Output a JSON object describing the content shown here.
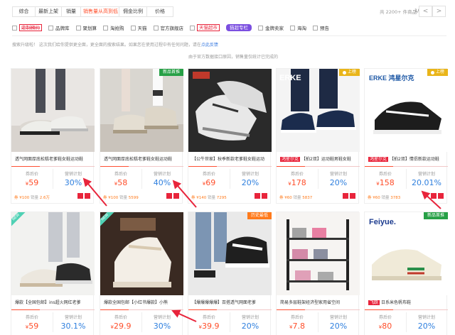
{
  "sort": {
    "buttons": [
      "综合",
      "最新上架",
      "销量",
      "销售量从高到低",
      "佣金比例",
      "价格"
    ],
    "total": "共 2200+ 件商品",
    "page": "1/23",
    "prev": "<",
    "next": ">"
  },
  "filters": {
    "items": [
      "定制预约",
      "品牌库",
      "聚划算",
      "淘抢购",
      "天猫",
      "官方旗舰店",
      "天猫超市"
    ],
    "badge": "猫超专栏",
    "items2": [
      "金牌卖家",
      "海淘",
      "预告"
    ]
  },
  "notice": {
    "text": "搜索升级啦！ 这次我们给你提供更全面，更全面的搜索结果。如果您在使用过程中有任何问题，请在",
    "link": "点此反馈",
    "text2": "由于官方数据接口原因，销售量仅统计已完成的"
  },
  "labels": {
    "coupon": "券后价",
    "plan": "营销计划"
  },
  "products": [
    {
      "tag": "",
      "shop": "",
      "title": "透气网面厚底松糕老爹鞋女鞋运动鞋",
      "price": "59",
      "rate": "30%",
      "coupon": "券 ¥100",
      "sales_label": "销量",
      "sales": "2.6万"
    },
    {
      "tag": "新品首推",
      "shop": "",
      "title": "透气网面厚底松糕老爹鞋女鞋运动鞋",
      "price": "58",
      "rate": "40%",
      "coupon": "券 ¥100",
      "sales_label": "销量",
      "sales": "5599"
    },
    {
      "tag": "",
      "shop": "",
      "title": "【公牛世家】秋季新款老爹鞋女鞋运动",
      "price": "69",
      "rate": "20%",
      "coupon": "券 ¥140",
      "sales_label": "销量",
      "sales": "7295"
    },
    {
      "tag": "上榜",
      "shop": "鸿星尔克",
      "title": "【拍2双】运动鞋男鞋女鞋",
      "price": "178",
      "rate": "20%",
      "coupon": "券 ¥60",
      "sales_label": "销量",
      "sales": "5837"
    },
    {
      "tag": "上榜",
      "shop": "鸿星尔克",
      "title": "【拍2双】情侣新款运动鞋",
      "price": "158",
      "rate": "20.01%",
      "coupon": "券 ¥60",
      "sales_label": "销量",
      "sales": "3783"
    },
    {
      "tag": "",
      "shop": "",
      "title": "爆款【全国包邮】ins超火网红老爹",
      "price": "59",
      "rate": "30.1%",
      "coupon": "",
      "sales_label": "",
      "sales": ""
    },
    {
      "tag": "",
      "shop": "",
      "title": "爆款全国包邮【小红书爆款】小熊",
      "price": "29.9",
      "rate": "30%",
      "coupon": "",
      "sales_label": "",
      "sales": ""
    },
    {
      "tag": "历史最低",
      "shop": "",
      "title": "【爆爆爆爆爆】百搭透气网面老爹",
      "price": "39.9",
      "rate": "20%",
      "coupon": "",
      "sales_label": "",
      "sales": ""
    },
    {
      "tag": "",
      "shop": "",
      "title": "简易多层鞋架经济型家用省空间",
      "price": "7.8",
      "rate": "20%",
      "coupon": "",
      "sales_label": "",
      "sales": ""
    },
    {
      "tag": "新品首推",
      "shop": "飞跃",
      "title": "日系米色帆布鞋",
      "price": "80",
      "rate": "20%",
      "coupon": "",
      "sales_label": "",
      "sales": ""
    }
  ],
  "brand_logos": [
    "ERKE",
    "ERKE 鸿星尔克",
    "Feiyue."
  ],
  "colors": {
    "accent": "#ff4e2a",
    "rate": "#2e7fde",
    "arrow": "#e8243b",
    "tag_green": "#27a046",
    "tag_gold": "#e9b51a"
  }
}
